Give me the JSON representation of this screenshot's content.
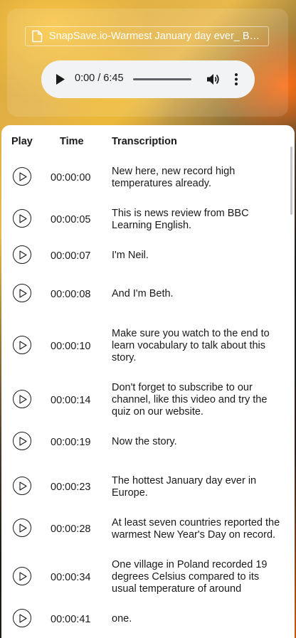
{
  "file_title": "SnapSave.io-Warmest January day ever_ BBC Learning English",
  "player": {
    "time_display": "0:00 / 6:45",
    "progress": 0
  },
  "table": {
    "headers": {
      "play": "Play",
      "time": "Time",
      "transcription": "Transcription"
    },
    "rows": [
      {
        "time": "00:00:00",
        "text": "New here, new record high temperatures already."
      },
      {
        "time": "00:00:05",
        "text": "This is news review from BBC Learning English."
      },
      {
        "time": "00:00:07",
        "text": "I'm Neil."
      },
      {
        "time": "00:00:08",
        "text": "And I'm Beth."
      },
      {
        "time": "00:00:10",
        "text": "Make sure you watch to the end to learn vocabulary to talk about this story."
      },
      {
        "time": "00:00:14",
        "text": "Don't forget to subscribe to our channel, like this video and try the quiz on our website."
      },
      {
        "time": "00:00:19",
        "text": "Now the story."
      },
      {
        "time": "00:00:23",
        "text": "The hottest January day ever in Europe."
      },
      {
        "time": "00:00:28",
        "text": "At least seven countries reported the warmest New Year's Day on record."
      },
      {
        "time": "00:00:34",
        "text": "One village in Poland recorded 19 degrees Celsius compared to its usual temperature of around"
      },
      {
        "time": "00:00:41",
        "text": "one."
      }
    ]
  }
}
